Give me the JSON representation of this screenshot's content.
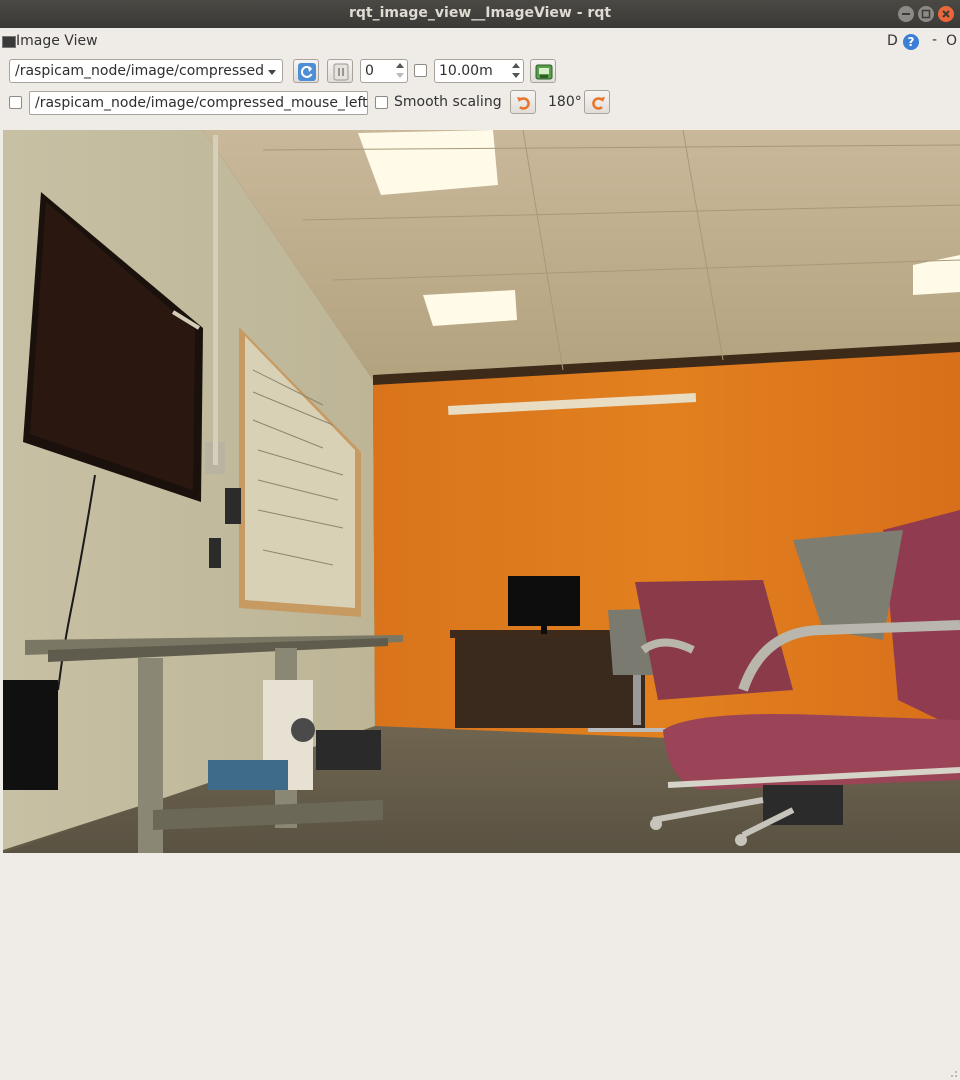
{
  "window": {
    "title": "rqt_image_view__ImageView - rqt"
  },
  "dock": {
    "title": "Image View",
    "d_label": "D",
    "help": "?",
    "minimize": "-",
    "close": "O"
  },
  "toolbar": {
    "topic": "/raspicam_node/image/compressed",
    "spin_value": "0",
    "max_range": "10.00m",
    "mouse_topic": "/raspicam_node/image/compressed_mouse_left",
    "smooth_scaling_label": "Smooth scaling",
    "rotation_label": "180°"
  },
  "icons": {
    "refresh": "refresh-icon",
    "pause": "pause-icon",
    "save": "save-image-icon",
    "rotate_left": "rotate-left-icon",
    "rotate_right": "rotate-right-icon"
  },
  "colors": {
    "title_bar": "#3b3a36",
    "close_button": "#e9673a",
    "panel_bg": "#efebe7",
    "accent_orange": "#e8742a"
  }
}
